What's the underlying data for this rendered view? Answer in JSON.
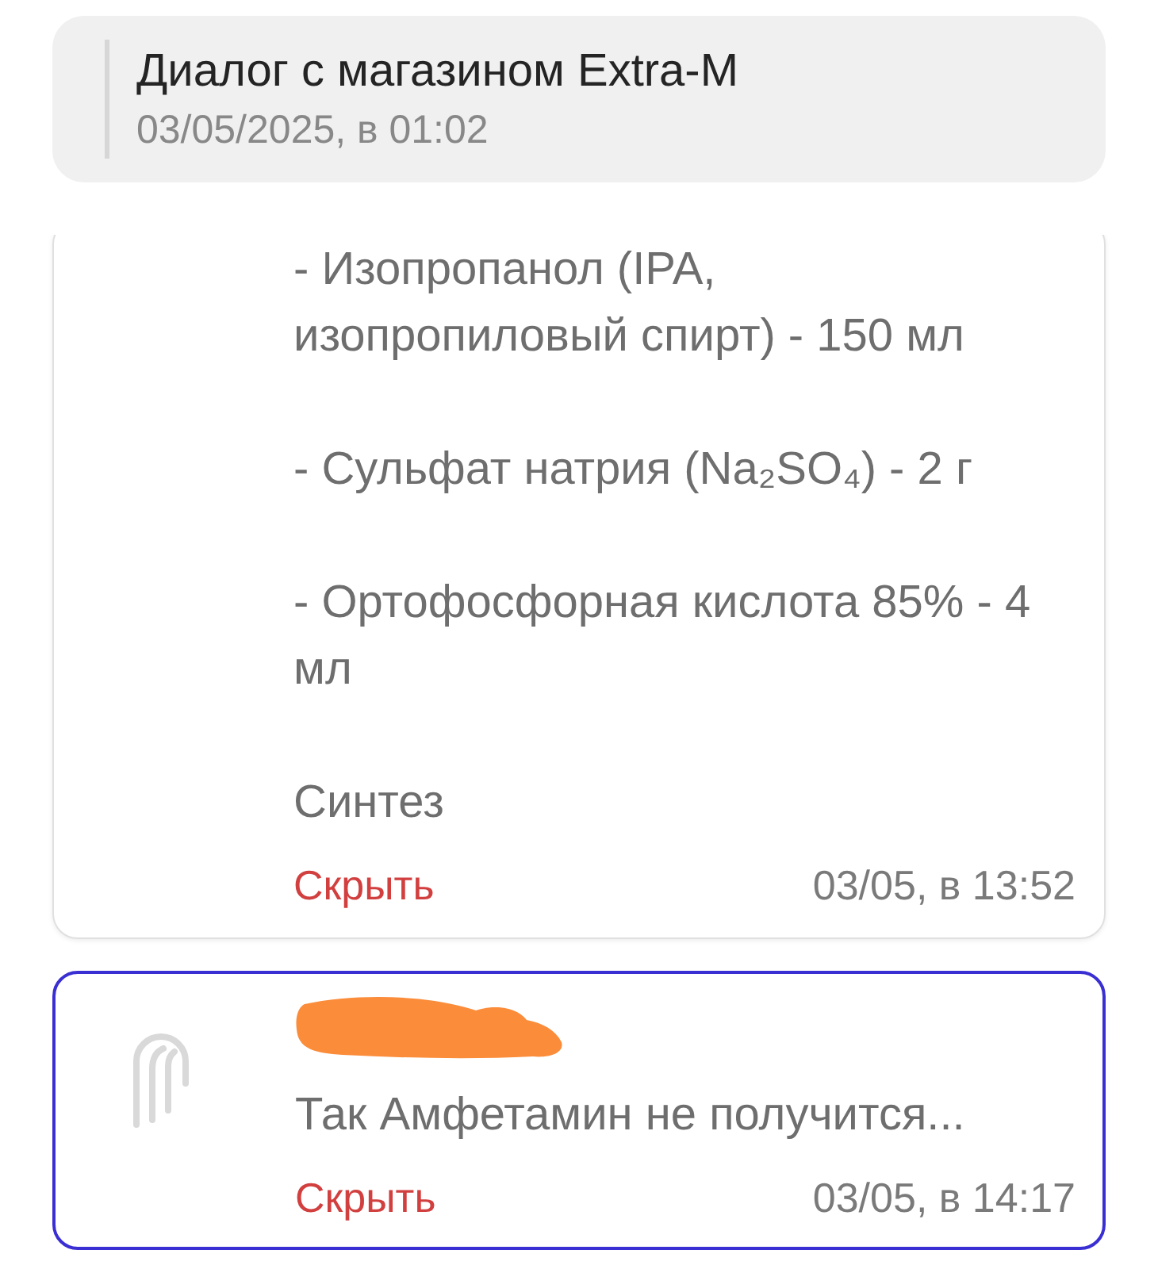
{
  "header": {
    "title": "Диалог с магазином Extra-M",
    "date": "03/05/2025, в 01:02"
  },
  "messages": [
    {
      "highlighted": false,
      "avatar": false,
      "sender_redacted": false,
      "paragraphs": [
        "- Изопропанол (IPA, изопропиловый спирт) - 150 мл",
        "- Сульфат натрия (Na₂SO₄) - 2 г",
        "- Ортофосфорная кислота 85% - 4 мл",
        "Синтез"
      ],
      "hide_link": "Скрыть",
      "time": "03/05, в 13:52"
    },
    {
      "highlighted": true,
      "avatar": true,
      "sender_redacted": true,
      "paragraphs": [
        "Так Амфетамин не получится..."
      ],
      "hide_link": "Скрыть",
      "time": "03/05, в 14:17"
    }
  ]
}
